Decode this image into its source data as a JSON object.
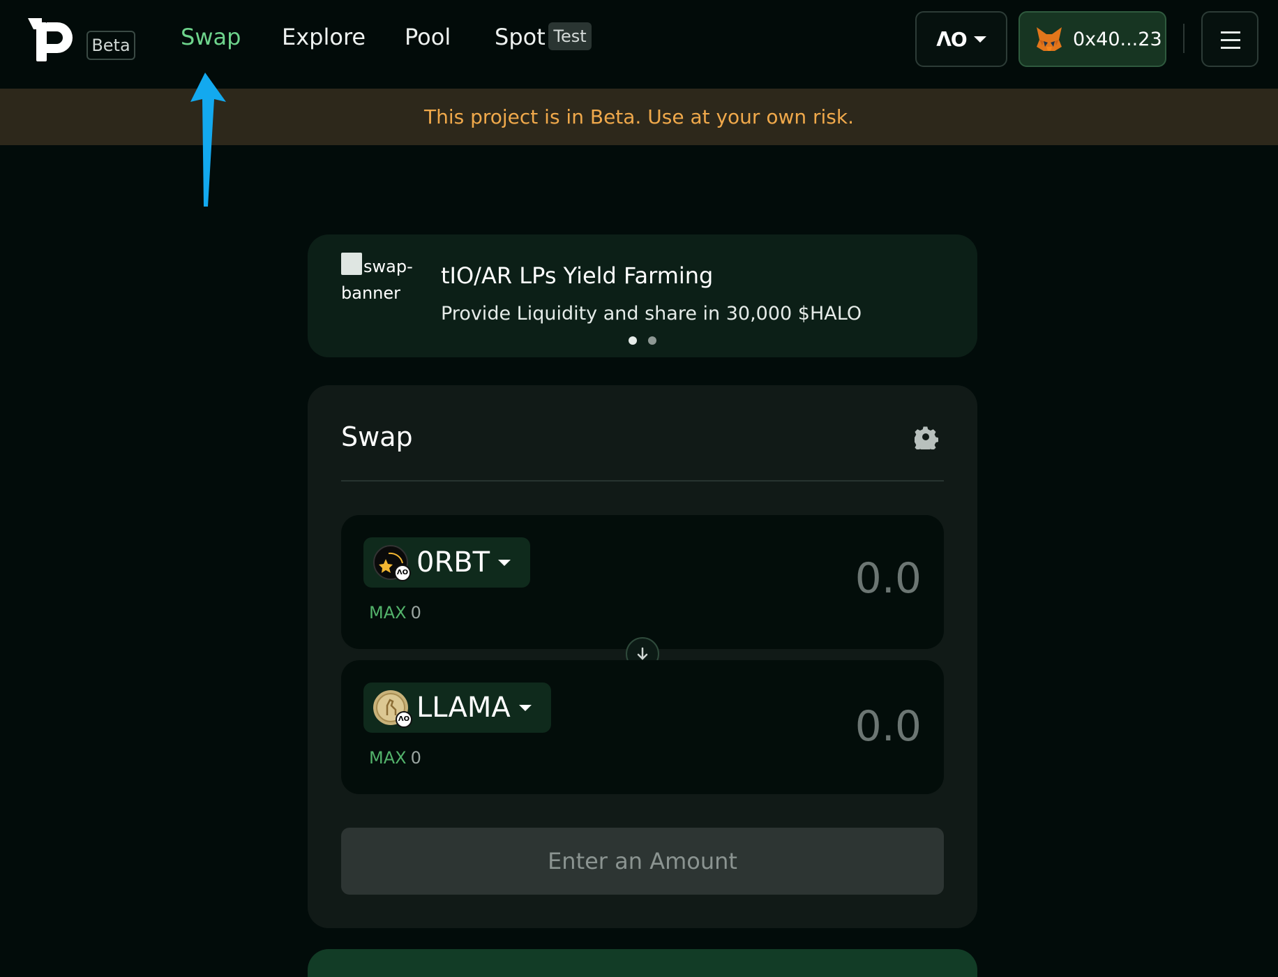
{
  "header": {
    "logo": "p-logo",
    "beta_label": "Beta",
    "nav": [
      {
        "label": "Swap",
        "active": true
      },
      {
        "label": "Explore",
        "active": false
      },
      {
        "label": "Pool",
        "active": false
      },
      {
        "label": "Spot",
        "active": false
      }
    ],
    "spot_badge": "Test",
    "network_label": "ΛO",
    "wallet_address": "0x40...23",
    "menu_icon": "hamburger-icon"
  },
  "notice": {
    "text": "This project is in Beta. Use at your own risk."
  },
  "banner": {
    "image_alt": "swap-banner",
    "title": "tIO/AR LPs Yield Farming",
    "subtitle": "Provide Liquidity and share in 30,000 $HALO",
    "slides": 2,
    "active_slide": 1
  },
  "swap": {
    "title": "Swap",
    "settings_icon": "gear-icon",
    "from": {
      "symbol": "0RBT",
      "max_label": "MAX",
      "max_value": "0",
      "amount_placeholder": "0.0"
    },
    "to": {
      "symbol": "LLAMA",
      "max_label": "MAX",
      "max_value": "0",
      "amount_placeholder": "0.0"
    },
    "submit_label": "Enter an Amount"
  },
  "colors": {
    "accent_green": "#6ed48c",
    "max_green": "#53b36b",
    "notice_text": "#f0a94b",
    "notice_bg": "#2d281b",
    "arrow_blue": "#13a9ef"
  }
}
